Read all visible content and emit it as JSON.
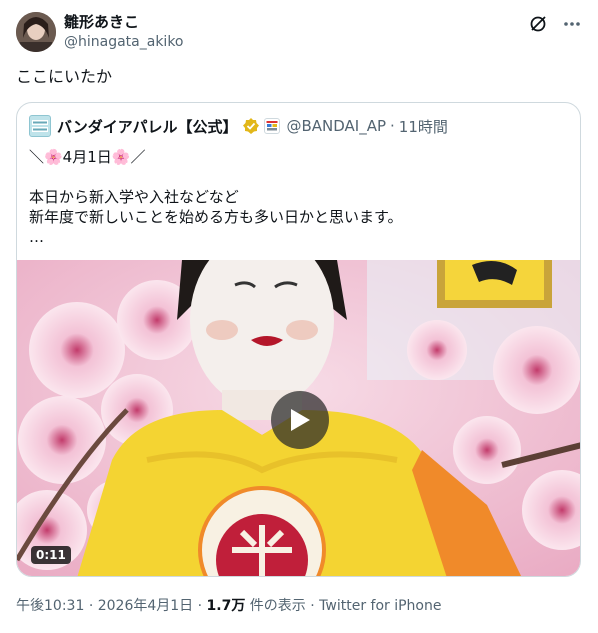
{
  "author": {
    "display_name": "雛形あきこ",
    "handle": "@hinagata_akiko",
    "avatar_icon": "avatar-photo"
  },
  "header_icons": [
    "grok-icon",
    "more-icon"
  ],
  "tweet": {
    "text": "ここにいたか"
  },
  "quote": {
    "display_name": "バンダイアパレル【公式】",
    "avatar_text": "BANDAI APPAREL",
    "verified_color": "#e2b719",
    "handle": "@BANDAI_AP",
    "separator": "·",
    "time": "11時間",
    "lines": [
      "＼🌸4月1日🌸／",
      "",
      "本日から新入学や入社などなど",
      "新年度で新しいことを始める方も多い日かと思います。",
      "…"
    ],
    "video": {
      "duration": "0:11",
      "play_icon": "play-icon"
    }
  },
  "meta": {
    "time": "午後10:31",
    "sep1": "·",
    "date": "2026年4月1日",
    "sep2": "·",
    "views": "1.7万",
    "views_label": "件の表示",
    "sep3": "·",
    "source": "Twitter for iPhone"
  },
  "colors": {
    "text": "#0f1419",
    "secondary": "#536471",
    "border": "#cfd9de"
  }
}
